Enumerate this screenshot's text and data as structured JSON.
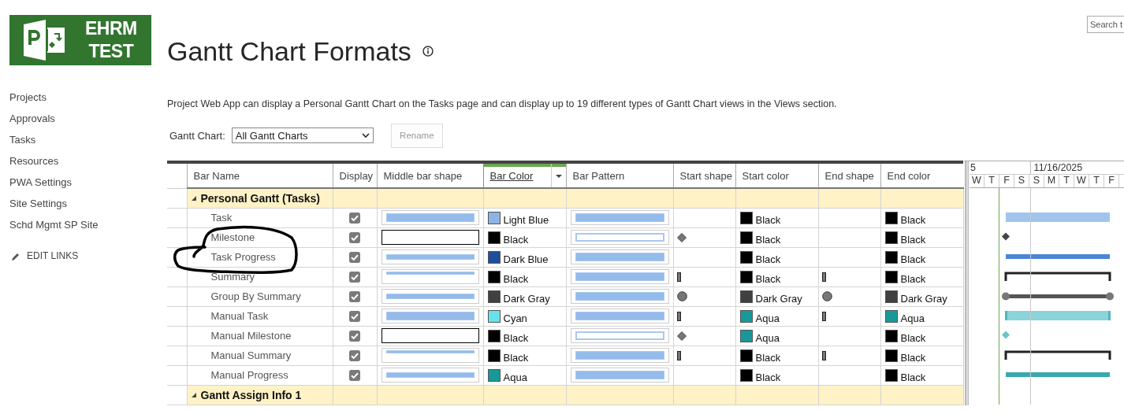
{
  "logo": {
    "lines": [
      "EHRM",
      "TEST"
    ]
  },
  "search": {
    "placeholder": "Search t"
  },
  "page_title": "Gantt Chart Formats",
  "nav": [
    "Projects",
    "Approvals",
    "Tasks",
    "Resources",
    "PWA Settings",
    "Site Settings",
    "Schd Mgmt SP Site"
  ],
  "edit_links": "EDIT LINKS",
  "description": "Project Web App can display a Personal Gantt Chart on the Tasks page and can display up to 19 different types of Gantt Chart views in the Views section.",
  "gantt_chart_select": {
    "label": "Gantt Chart:",
    "value": "All Gantt Charts"
  },
  "rename_button": {
    "label": "Rename",
    "disabled": true
  },
  "table": {
    "columns": [
      {
        "label": "Bar Name",
        "selected": false
      },
      {
        "label": "Display",
        "selected": false
      },
      {
        "label": "Middle bar shape",
        "selected": false
      },
      {
        "label": "Bar Color",
        "selected": true
      },
      {
        "label": "Bar Pattern",
        "selected": false
      },
      {
        "label": "Start shape",
        "selected": false
      },
      {
        "label": "Start color",
        "selected": false
      },
      {
        "label": "End shape",
        "selected": false
      },
      {
        "label": "End color",
        "selected": false
      }
    ],
    "groups": [
      {
        "name": "Personal Gantt (Tasks)",
        "expanded": true,
        "rows": [
          {
            "kind": "task",
            "name": "Task",
            "display": true,
            "middle_shape": {
              "kind": "full"
            },
            "bar_color": {
              "label": "Light Blue",
              "color": "#8db4e2"
            },
            "bar_pattern": {
              "kind": "solid"
            },
            "start_color": {
              "label": "Black",
              "color": "#000000"
            },
            "end_color": {
              "label": "Black",
              "color": "#000000"
            }
          },
          {
            "kind": "milestone",
            "name": "Milestone",
            "display": true,
            "middle_shape": {
              "kind": "empty"
            },
            "bar_color": {
              "label": "Black",
              "color": "#000000"
            },
            "bar_pattern": {
              "kind": "hollow"
            },
            "start_shape": {
              "kind": "diamond"
            },
            "start_color": {
              "label": "Black",
              "color": "#000000"
            },
            "end_color": {
              "label": "Black",
              "color": "#000000"
            }
          },
          {
            "kind": "progress",
            "name": "Task Progress",
            "display": true,
            "middle_shape": {
              "kind": "middle"
            },
            "bar_color": {
              "label": "Dark Blue",
              "color": "#1f4e9c"
            },
            "bar_pattern": {
              "kind": "solid"
            },
            "start_color": {
              "label": "Black",
              "color": "#000000"
            },
            "end_color": {
              "label": "Black",
              "color": "#000000"
            }
          },
          {
            "kind": "summary",
            "name": "Summary",
            "display": true,
            "middle_shape": {
              "kind": "top"
            },
            "bar_color": {
              "label": "Black",
              "color": "#000000"
            },
            "bar_pattern": {
              "kind": "solid"
            },
            "start_shape": {
              "kind": "bar"
            },
            "start_color": {
              "label": "Black",
              "color": "#000000"
            },
            "end_shape": {
              "kind": "bar"
            },
            "end_color": {
              "label": "Black",
              "color": "#000000"
            }
          },
          {
            "kind": "group",
            "name": "Group By Summary",
            "display": true,
            "middle_shape": {
              "kind": "middle"
            },
            "bar_color": {
              "label": "Dark Gray",
              "color": "#404040"
            },
            "bar_pattern": {
              "kind": "solid"
            },
            "start_shape": {
              "kind": "circle"
            },
            "start_color": {
              "label": "Dark Gray",
              "color": "#404040"
            },
            "end_shape": {
              "kind": "circle"
            },
            "end_color": {
              "label": "Dark Gray",
              "color": "#404040"
            }
          },
          {
            "kind": "manual-task",
            "name": "Manual Task",
            "display": true,
            "middle_shape": {
              "kind": "full"
            },
            "bar_color": {
              "label": "Cyan",
              "color": "#66e3ea"
            },
            "bar_pattern": {
              "kind": "solid"
            },
            "start_shape": {
              "kind": "bar"
            },
            "start_color": {
              "label": "Aqua",
              "color": "#17999b"
            },
            "end_shape": {
              "kind": "bar"
            },
            "end_color": {
              "label": "Aqua",
              "color": "#17999b"
            }
          },
          {
            "kind": "manual-milestone",
            "name": "Manual Milestone",
            "display": true,
            "middle_shape": {
              "kind": "empty"
            },
            "bar_color": {
              "label": "Black",
              "color": "#000000"
            },
            "bar_pattern": {
              "kind": "hollow"
            },
            "start_shape": {
              "kind": "diamond"
            },
            "start_color": {
              "label": "Aqua",
              "color": "#17999b"
            },
            "end_color": {
              "label": "Black",
              "color": "#000000"
            }
          },
          {
            "kind": "manual-summary",
            "name": "Manual Summary",
            "display": true,
            "middle_shape": {
              "kind": "top"
            },
            "bar_color": {
              "label": "Black",
              "color": "#000000"
            },
            "bar_pattern": {
              "kind": "solid"
            },
            "start_shape": {
              "kind": "bar"
            },
            "start_color": {
              "label": "Black",
              "color": "#000000"
            },
            "end_shape": {
              "kind": "bar"
            },
            "end_color": {
              "label": "Black",
              "color": "#000000"
            }
          },
          {
            "kind": "manual-progress",
            "name": "Manual Progress",
            "display": true,
            "middle_shape": {
              "kind": "middle"
            },
            "bar_color": {
              "label": "Aqua",
              "color": "#17999b"
            },
            "bar_pattern": {
              "kind": "solid"
            },
            "start_color": {
              "label": "Black",
              "color": "#000000"
            },
            "end_color": {
              "label": "Black",
              "color": "#000000"
            }
          }
        ]
      },
      {
        "name": "Gantt Assign Info 1",
        "expanded": true
      }
    ]
  },
  "timeline": {
    "dates": [
      "5",
      "11/16/2025"
    ],
    "days": [
      "W",
      "T",
      "F",
      "S",
      "S",
      "M",
      "T",
      "W",
      "T",
      "F"
    ]
  }
}
